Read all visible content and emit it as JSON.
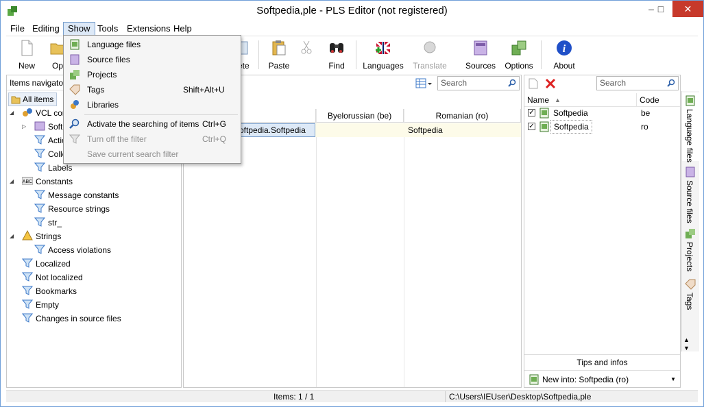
{
  "window": {
    "title": "Softpedia,ple - PLS Editor (not registered)",
    "minimize": "–",
    "maximize": "□",
    "close": "✕"
  },
  "menubar": [
    {
      "label": "File"
    },
    {
      "label": "Editing"
    },
    {
      "label": "Show"
    },
    {
      "label": "Tools"
    },
    {
      "label": "Extensions"
    },
    {
      "label": "Help"
    }
  ],
  "toolbar": {
    "new": "New",
    "open": "Op",
    "delete": "lete",
    "paste": "Paste",
    "find": "Find",
    "languages": "Languages",
    "translate": "Translate",
    "sources": "Sources",
    "options": "Options",
    "about": "About"
  },
  "show_menu": {
    "items": [
      {
        "label": "Language files",
        "shortcut": ""
      },
      {
        "label": "Source files",
        "shortcut": ""
      },
      {
        "label": "Projects",
        "shortcut": ""
      },
      {
        "label": "Tags",
        "shortcut": "Shift+Alt+U"
      },
      {
        "label": "Libraries",
        "shortcut": ""
      },
      {
        "label": "Activate the searching of items",
        "shortcut": "Ctrl+G"
      },
      {
        "label": "Turn off the filter",
        "shortcut": "Ctrl+Q"
      },
      {
        "label": "Save current search filter",
        "shortcut": ""
      }
    ]
  },
  "navigator": {
    "header": "Items navigato",
    "tab_all": "All items",
    "tree": [
      {
        "label": "VCL com"
      },
      {
        "label": "Softp"
      },
      {
        "label": "Actio"
      },
      {
        "label": "Colle"
      },
      {
        "label": "Labels"
      },
      {
        "label": "Constants"
      },
      {
        "label": "Message constants"
      },
      {
        "label": "Resource strings"
      },
      {
        "label": "str_"
      },
      {
        "label": "Strings"
      },
      {
        "label": "Access violations"
      },
      {
        "label": "Localized"
      },
      {
        "label": "Not localized"
      },
      {
        "label": "Bookmarks"
      },
      {
        "label": "Empty"
      },
      {
        "label": "Changes in source files"
      }
    ]
  },
  "grid": {
    "search_placeholder": "Search",
    "columns": [
      "",
      "Byelorussian (be)",
      "Romanian (ro)"
    ],
    "rows": [
      {
        "id": "oftpedia.Softpedia",
        "be": "",
        "ro": "Softpedia"
      }
    ]
  },
  "languages_panel": {
    "search_placeholder": "Search",
    "col_name": "Name",
    "col_code": "Code",
    "rows": [
      {
        "name": "Softpedia",
        "code": "be",
        "checked": "✓"
      },
      {
        "name": "Softpedia",
        "code": "ro",
        "checked": "✓"
      }
    ],
    "tips": "Tips and infos",
    "new_into": "New into: Softpedia (ro)"
  },
  "side_tabs": [
    "Language files",
    "Source files",
    "Projects",
    "Tags"
  ],
  "status": {
    "items": "Items: 1 / 1",
    "path": "C:\\Users\\IEUser\\Desktop\\Softpedia,ple"
  },
  "colors": {
    "accent": "#3c78c8",
    "highlight_row": "#fdfbe9",
    "close_button": "#c7392b",
    "menu_active": "#dde9f7"
  }
}
